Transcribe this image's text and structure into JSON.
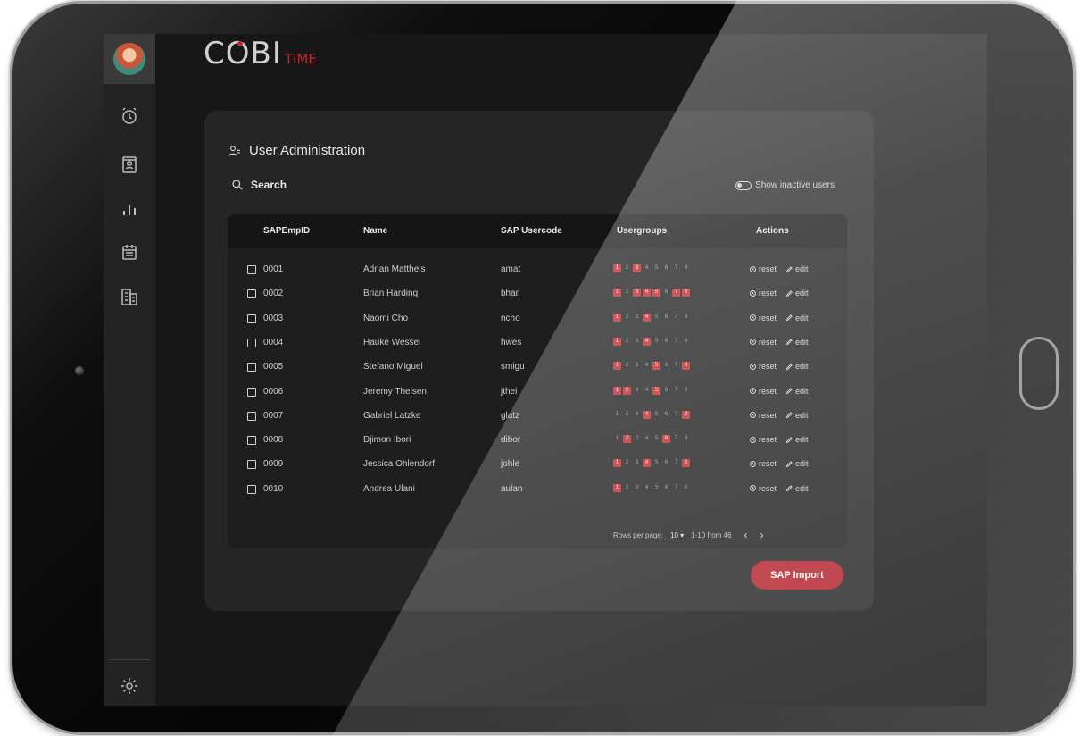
{
  "app": {
    "logo_main": "COBI",
    "logo_sub": "TIME"
  },
  "sidebar": {
    "items": [
      "clock-icon",
      "badge-icon",
      "chart-icon",
      "calendar-icon",
      "building-icon"
    ],
    "footer": "gear-icon"
  },
  "page": {
    "title": "User Administration",
    "search_placeholder": "Search",
    "show_inactive": "Show inactive users"
  },
  "table": {
    "headers": {
      "id": "SAPEmpID",
      "name": "Name",
      "usercode": "SAP Usercode",
      "groups": "Usergroups",
      "actions": "Actions"
    },
    "group_labels": [
      "1",
      "2",
      "3",
      "4",
      "5",
      "6",
      "7",
      "8"
    ],
    "rows": [
      {
        "id": "0001",
        "name": "Adrian Mattheis",
        "code": "amat",
        "groups": [
          1,
          0,
          1,
          0,
          0,
          0,
          0,
          0
        ]
      },
      {
        "id": "0002",
        "name": "Brian Harding",
        "code": "bhar",
        "groups": [
          1,
          0,
          1,
          1,
          1,
          0,
          1,
          1
        ]
      },
      {
        "id": "0003",
        "name": "Naomi Cho",
        "code": "ncho",
        "groups": [
          1,
          0,
          0,
          1,
          0,
          0,
          0,
          0
        ]
      },
      {
        "id": "0004",
        "name": "Hauke Wessel",
        "code": "hwes",
        "groups": [
          1,
          0,
          0,
          1,
          0,
          0,
          0,
          0
        ]
      },
      {
        "id": "0005",
        "name": "Stefano Miguel",
        "code": "smigu",
        "groups": [
          1,
          0,
          0,
          0,
          1,
          0,
          0,
          1
        ]
      },
      {
        "id": "0006",
        "name": "Jeremy Theisen",
        "code": "jthei",
        "groups": [
          1,
          1,
          0,
          0,
          1,
          0,
          0,
          0
        ]
      },
      {
        "id": "0007",
        "name": "Gabriel Latzke",
        "code": "glatz",
        "groups": [
          0,
          0,
          0,
          1,
          0,
          0,
          0,
          1
        ]
      },
      {
        "id": "0008",
        "name": "Djimon Ibori",
        "code": "dibor",
        "groups": [
          0,
          1,
          0,
          0,
          0,
          1,
          0,
          0
        ]
      },
      {
        "id": "0009",
        "name": "Jessica Ohlendorf",
        "code": "johle",
        "groups": [
          1,
          0,
          0,
          1,
          0,
          0,
          0,
          1
        ]
      },
      {
        "id": "0010",
        "name": "Andrea Ulani",
        "code": "aulan",
        "groups": [
          1,
          0,
          0,
          0,
          0,
          0,
          0,
          0
        ]
      }
    ],
    "reset_label": "reset",
    "edit_label": "edit"
  },
  "pagination": {
    "rows_label": "Rows per page:",
    "rows_value": "10",
    "range": "1-10 from 46"
  },
  "sap_import": "SAP Import",
  "colors": {
    "accent": "#c0262b",
    "background": "#171717",
    "card": "#252525"
  }
}
